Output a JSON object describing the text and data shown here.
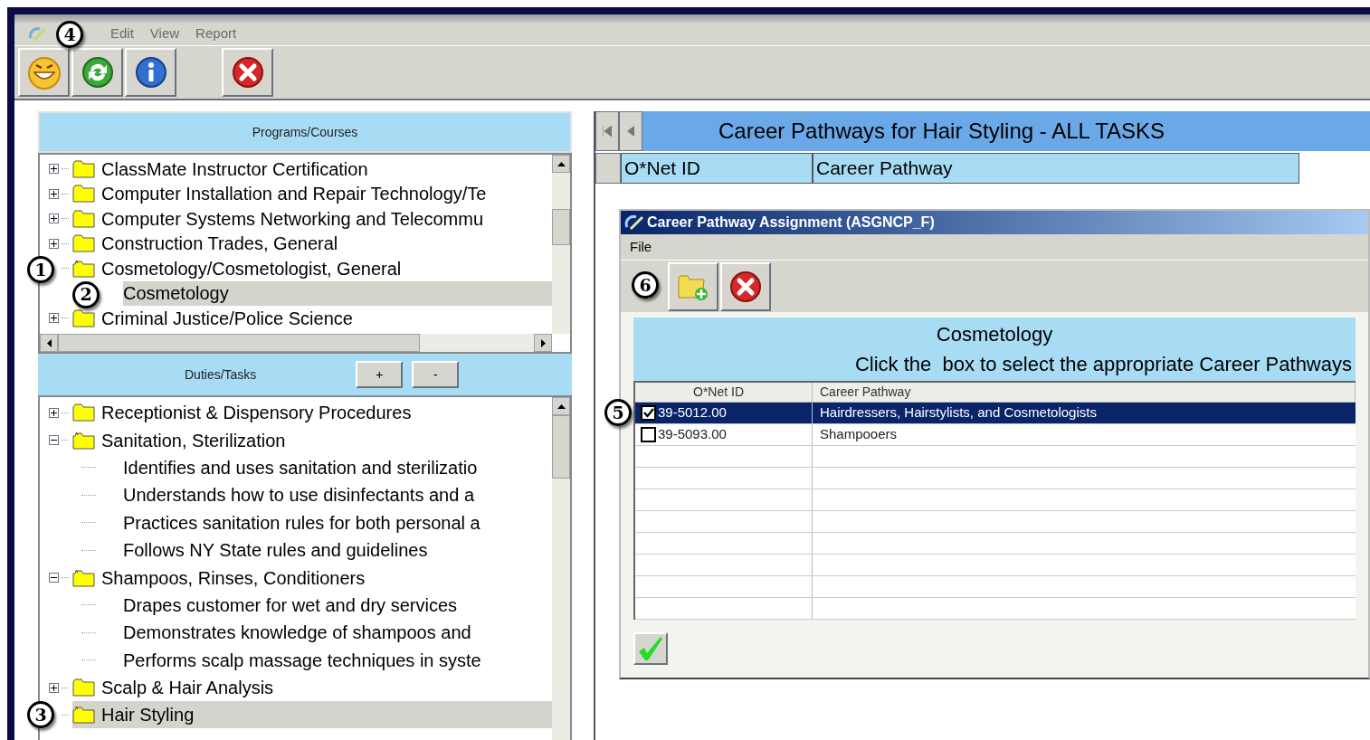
{
  "menu": {
    "callout": "4",
    "items": [
      "Edit",
      "View",
      "Report"
    ]
  },
  "toolbar": [
    {
      "kind": "smiley"
    },
    {
      "kind": "refresh"
    },
    {
      "kind": "info"
    },
    {
      "kind": "close"
    }
  ],
  "programs": {
    "title": "Programs/Courses",
    "items": [
      {
        "label": "ClassMate Instructor Certification",
        "expanded": false,
        "selected": false
      },
      {
        "label": "Computer Installation and Repair Technology/Te",
        "expanded": false,
        "selected": false
      },
      {
        "label": "Computer Systems Networking and Telecommu",
        "expanded": false,
        "selected": false
      },
      {
        "label": "Construction Trades, General",
        "expanded": false,
        "selected": false
      },
      {
        "label": "Cosmetology/Cosmetologist, General",
        "expanded": true,
        "selected": false,
        "callout": "1",
        "children": [
          {
            "label": "Cosmetology",
            "selected": true,
            "callout": "2"
          }
        ]
      },
      {
        "label": "Criminal Justice/Police Science",
        "expanded": false,
        "selected": false
      }
    ]
  },
  "tasks": {
    "title": "Duties/Tasks",
    "buttons": [
      "+",
      "-"
    ],
    "items": [
      {
        "label": "Receptionist & Dispensory Procedures",
        "expanded": false,
        "selected": false
      },
      {
        "label": "Sanitation, Sterilization",
        "expanded": true,
        "selected": false,
        "children": [
          {
            "label": "Identifies and uses sanitation and sterilizatio",
            "selected": false
          },
          {
            "label": "Understands how to use disinfectants and a",
            "selected": false
          },
          {
            "label": "Practices sanitation rules for both personal a",
            "selected": false
          },
          {
            "label": "Follows NY State rules and guidelines",
            "selected": false
          }
        ]
      },
      {
        "label": "Shampoos, Rinses, Conditioners",
        "expanded": true,
        "selected": false,
        "children": [
          {
            "label": "Drapes customer for wet and dry services",
            "selected": false
          },
          {
            "label": "Demonstrates knowledge of shampoos and",
            "selected": false
          },
          {
            "label": "Performs scalp massage techniques in syste",
            "selected": false
          }
        ]
      },
      {
        "label": "Scalp & Hair Analysis",
        "expanded": false,
        "selected": false
      },
      {
        "label": "Hair Styling",
        "expanded": true,
        "selected": true,
        "callout": "3"
      }
    ]
  },
  "pathways": {
    "title": "Career Pathways for Hair Styling - ALL TASKS",
    "columns": [
      "O*Net ID",
      "Career Pathway"
    ]
  },
  "dialog": {
    "title": "Career Pathway Assignment (ASGNCP_F)",
    "menu": [
      "File"
    ],
    "toolbar_callout": "6",
    "heading": "Cosmetology",
    "instruction": "Click the  box to select the appropriate Career Pathways",
    "columns": [
      "O*Net ID",
      "Career Pathway"
    ],
    "rows": [
      {
        "id": "39-5012.00",
        "pathway": "Hairdressers, Hairstylists, and Cosmetologists",
        "checked": true,
        "selected": true,
        "callout": "5"
      },
      {
        "id": "39-5093.00",
        "pathway": "Shampooers",
        "checked": false,
        "selected": false
      }
    ]
  }
}
